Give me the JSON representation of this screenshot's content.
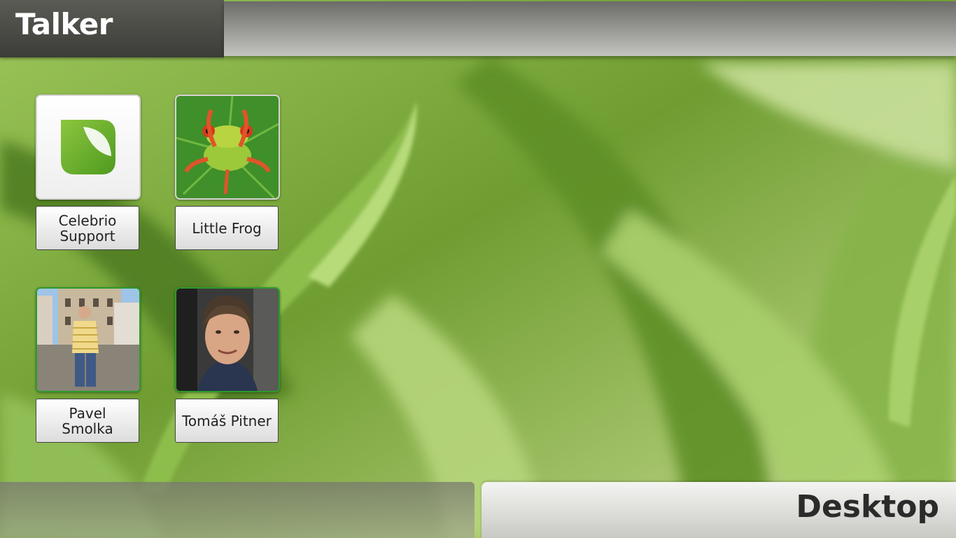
{
  "app": {
    "title": "Talker"
  },
  "contacts": [
    {
      "name": "Celebrio Support",
      "line1": "Celebrio",
      "line2": "Support",
      "avatar": "leaf-logo-icon",
      "online": false
    },
    {
      "name": "Little Frog",
      "line1": "Little Frog",
      "line2": "",
      "avatar": "frog-photo",
      "online": false
    },
    {
      "name": "Pavel Smolka",
      "line1": "Pavel",
      "line2": "Smolka",
      "avatar": "person-photo",
      "online": true
    },
    {
      "name": "Tomáš Pitner",
      "line1": "Tomáš Pitner",
      "line2": "",
      "avatar": "person-photo",
      "online": true
    }
  ],
  "footer": {
    "desktop_label": "Desktop"
  },
  "colors": {
    "online_border": "#2d9a2b",
    "header_dark": "#3c3d38",
    "background_green": "#6ea032"
  }
}
